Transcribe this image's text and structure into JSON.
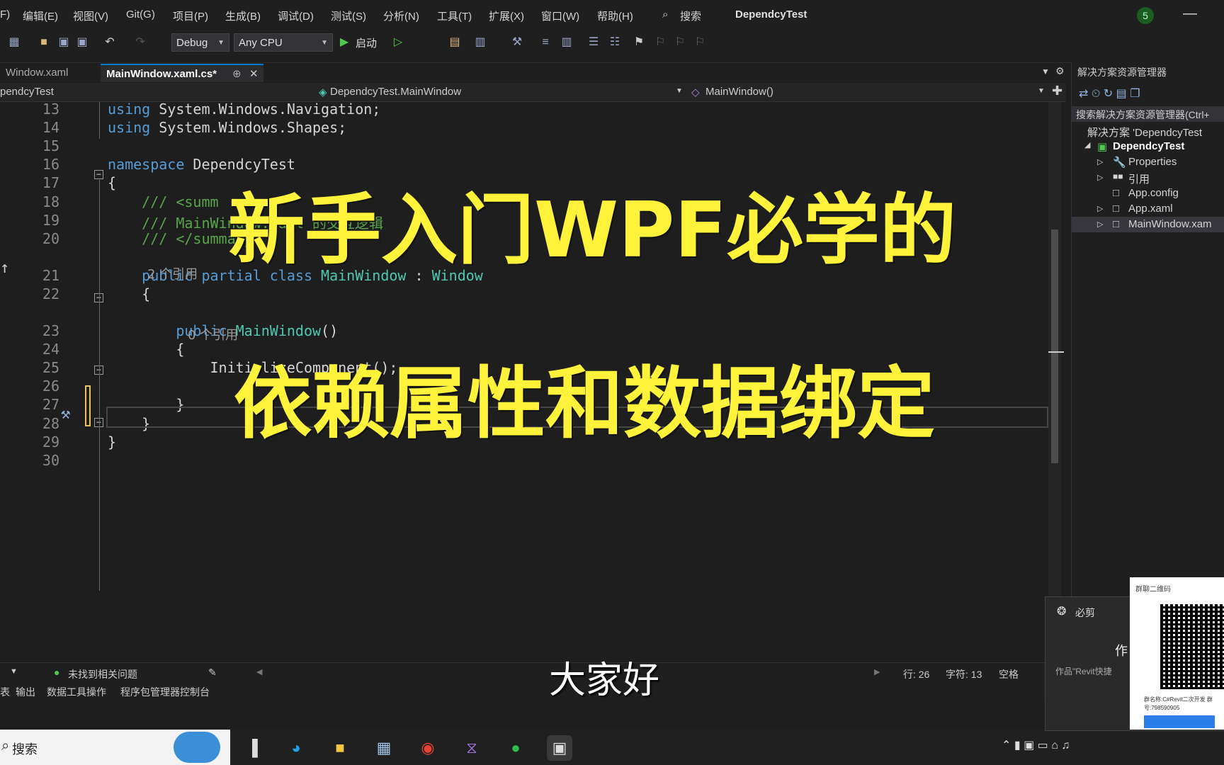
{
  "menu": [
    "F)",
    "编辑(E)",
    "视图(V)",
    "Git(G)",
    "项目(P)",
    "生成(B)",
    "调试(D)",
    "测试(S)",
    "分析(N)",
    "工具(T)",
    "扩展(X)",
    "窗口(W)",
    "帮助(H)"
  ],
  "search_label": "搜索",
  "window_title": "DependcyTest",
  "badge_count": "5",
  "toolbar": {
    "config": "Debug",
    "platform": "Any CPU",
    "start_label": "启动"
  },
  "tabs": [
    {
      "label": "Window.xaml",
      "active": false
    },
    {
      "label": "MainWindow.xaml.cs*",
      "active": true
    }
  ],
  "nav": {
    "project": "pendcyTest",
    "class": "DependcyTest.MainWindow",
    "member": "MainWindow()"
  },
  "code_lines": [
    {
      "n": "13",
      "parts": [
        [
          "kw",
          "using"
        ],
        [
          "tx",
          " System.Windows.Navigation;"
        ]
      ]
    },
    {
      "n": "14",
      "parts": [
        [
          "kw",
          "using"
        ],
        [
          "tx",
          " System.Windows.Shapes;"
        ]
      ]
    },
    {
      "n": "15",
      "parts": []
    },
    {
      "n": "16",
      "parts": [
        [
          "kw",
          "namespace"
        ],
        [
          "tx",
          " DependcyTest"
        ]
      ]
    },
    {
      "n": "17",
      "parts": [
        [
          "tx",
          "{"
        ]
      ]
    },
    {
      "n": "18",
      "parts": [
        [
          "cm",
          "    /// <summ"
        ]
      ]
    },
    {
      "n": "19",
      "parts": [
        [
          "cm",
          "    /// Main"
        ],
        [
          "cm",
          "Window.xaml 的交互逻辑"
        ]
      ]
    },
    {
      "n": "20",
      "parts": [
        [
          "cm",
          "    /// </summary>"
        ]
      ]
    },
    {
      "n": "21",
      "parts": [
        [
          "kw",
          "    public partial class "
        ],
        [
          "ty",
          "MainWindow"
        ],
        [
          "tx",
          " : "
        ],
        [
          "ty",
          "Window"
        ]
      ]
    },
    {
      "n": "22",
      "parts": [
        [
          "tx",
          "    {"
        ]
      ]
    },
    {
      "n": "23",
      "parts": [
        [
          "kw",
          "        public "
        ],
        [
          "ty",
          "MainWindow"
        ],
        [
          "tx",
          "()"
        ]
      ]
    },
    {
      "n": "24",
      "parts": [
        [
          "tx",
          "        {"
        ]
      ]
    },
    {
      "n": "25",
      "parts": [
        [
          "tx",
          "            InitializeComponent();"
        ]
      ]
    },
    {
      "n": "26",
      "parts": []
    },
    {
      "n": "27",
      "parts": [
        [
          "tx",
          "        }"
        ]
      ]
    },
    {
      "n": "28",
      "parts": [
        [
          "tx",
          "    }"
        ]
      ]
    },
    {
      "n": "29",
      "parts": [
        [
          "tx",
          "}"
        ]
      ]
    },
    {
      "n": "30",
      "parts": []
    }
  ],
  "codelens": {
    "refs_class": "2 个引用",
    "refs_ctor": "0 个引用"
  },
  "solution": {
    "panel_title": "解决方案资源管理器",
    "search_placeholder": "搜索解决方案资源管理器(Ctrl+",
    "items": [
      "解决方案 'DependcyTest",
      "DependcyTest",
      "Properties",
      "引用",
      "App.config",
      "App.xaml",
      "MainWindow.xam"
    ]
  },
  "overlay": {
    "line1": "新手入门WPF必学的",
    "line2": "依赖属性和数据绑定",
    "subtitle": "大家好"
  },
  "status": {
    "issues": "未找到相关问题",
    "row": "行: 26",
    "col": "字符: 13",
    "space": "空格"
  },
  "bottom_tabs": [
    "表",
    "输出",
    "数据工具操作",
    "程序包管理器控制台"
  ],
  "taskbar": {
    "search": "搜索"
  },
  "popup": {
    "title": "必剪",
    "text": "作",
    "subtext": "作品\"Revit快捷",
    "qr_title": "群聊二维码",
    "qr_info": "群名称:C#Revit二次开发 群号:798590905"
  },
  "colors": {
    "accent": "#007acc",
    "overlay_text": "#fff23a",
    "keyword": "#569cd6",
    "type": "#4ec9b0",
    "comment": "#57a64a"
  }
}
